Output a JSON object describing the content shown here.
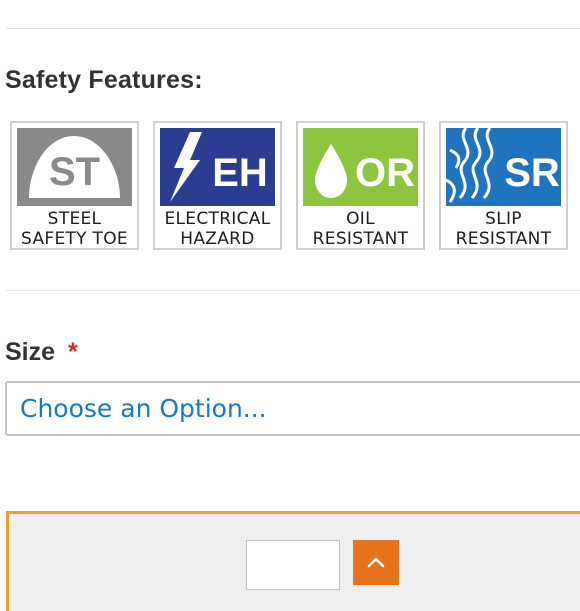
{
  "safety": {
    "title": "Safety Features:",
    "badges": [
      {
        "abbr": "ST",
        "line1": "STEEL",
        "line2": "SAFETY TOE",
        "color": "#8a8a8a"
      },
      {
        "abbr": "EH",
        "line1": "ELECTRICAL",
        "line2": "HAZARD",
        "color": "#2a3d91"
      },
      {
        "abbr": "OR",
        "line1": "OIL",
        "line2": "RESISTANT",
        "color": "#8cc63f"
      },
      {
        "abbr": "SR",
        "line1": "SLIP",
        "line2": "RESISTANT",
        "color": "#1f74bd"
      }
    ]
  },
  "size": {
    "label": "Size",
    "required_mark": "*",
    "selected": "Choose an Option..."
  },
  "colors": {
    "accent": "#e8711c",
    "panel_border": "#f0a030",
    "link_blue": "#1979c3",
    "required_red": "#e02b27"
  },
  "icons": {
    "qty_up": "chevron-up-icon"
  }
}
